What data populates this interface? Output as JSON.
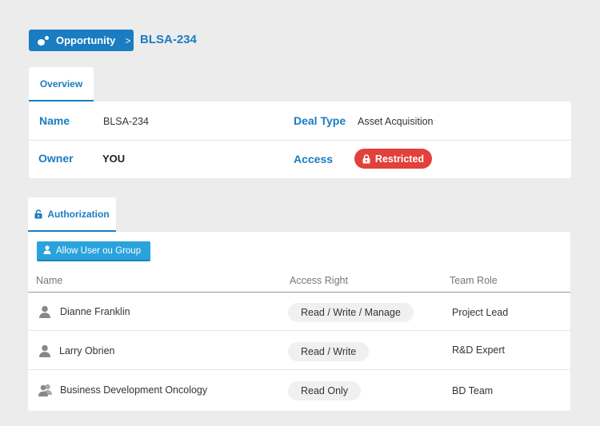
{
  "breadcrumb": {
    "parent_label": "Opportunity",
    "parent_icon": "opportunity-icon",
    "separator": ">",
    "current": "BLSA-234"
  },
  "overview": {
    "tab_label": "Overview",
    "fields": {
      "name_label": "Name",
      "name_value": "BLSA-234",
      "deal_type_label": "Deal Type",
      "deal_type_value": "Asset Acquisition",
      "owner_label": "Owner",
      "owner_value": "YOU",
      "access_label": "Access",
      "access_value": "Restricted",
      "access_icon": "lock-icon"
    },
    "colors": {
      "accent": "#1a7cc1",
      "restricted": "#e2403a"
    }
  },
  "authorization": {
    "tab_label": "Authorization",
    "tab_icon": "unlock-icon",
    "allow_button_label": "Allow User ou Group",
    "allow_button_color": "#2aa3dc",
    "columns": [
      "Name",
      "Access Right",
      "Team Role"
    ],
    "rows": [
      {
        "type": "user",
        "icon": "user-icon",
        "name": "Dianne Franklin",
        "access_right": "Read / Write / Manage",
        "team_role": "Project Lead"
      },
      {
        "type": "user",
        "icon": "user-icon",
        "name": "Larry Obrien",
        "access_right": "Read / Write",
        "team_role": "R&D Expert"
      },
      {
        "type": "group",
        "icon": "group-icon",
        "name": "Business Development Oncology",
        "access_right": "Read Only",
        "team_role": "BD Team"
      }
    ]
  }
}
